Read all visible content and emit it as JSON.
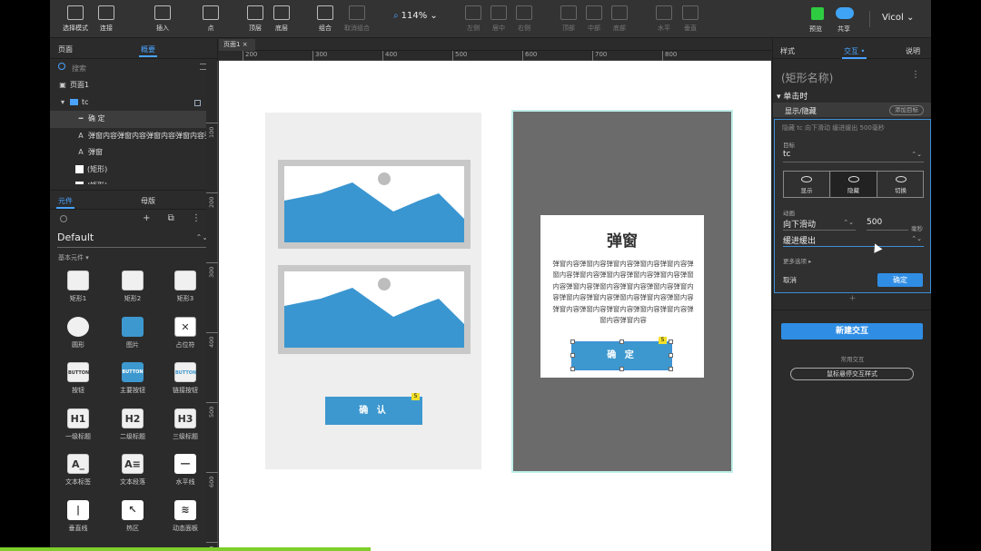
{
  "toolbar": {
    "left_tools": [
      {
        "label": "选择模式",
        "icon": "select-mode-icon"
      },
      {
        "label": "连接",
        "icon": "connect-icon"
      },
      {
        "label": "插入",
        "icon": "insert-icon"
      },
      {
        "label": "点",
        "icon": "point-icon"
      },
      {
        "label": "顶层",
        "icon": "bring-front-icon"
      },
      {
        "label": "底层",
        "icon": "send-back-icon"
      },
      {
        "label": "组合",
        "icon": "group-icon"
      },
      {
        "label": "取消组合",
        "icon": "ungroup-icon",
        "disabled": true
      }
    ],
    "zoom": "114%",
    "align_tools": [
      {
        "label": "左侧",
        "icon": "align-left-icon"
      },
      {
        "label": "居中",
        "icon": "align-center-icon"
      },
      {
        "label": "右侧",
        "icon": "align-right-icon"
      },
      {
        "label": "顶部",
        "icon": "align-top-icon"
      },
      {
        "label": "中部",
        "icon": "align-middle-icon"
      },
      {
        "label": "底部",
        "icon": "align-bottom-icon"
      },
      {
        "label": "水平",
        "icon": "distribute-horizontal-icon"
      },
      {
        "label": "垂直",
        "icon": "distribute-vertical-icon"
      }
    ],
    "preview_label": "预览",
    "share_label": "共享",
    "user": "Vicol"
  },
  "left_panel": {
    "tabs": [
      "页面",
      "概要"
    ],
    "active_tab": "概要",
    "search_placeholder": "搜索",
    "outline": [
      {
        "glyph": "▣",
        "label": "页面1",
        "indent": 0
      },
      {
        "glyph": "▾",
        "label": "tc",
        "indent": 0,
        "folder": true
      },
      {
        "glyph": "━",
        "label": "确 定",
        "indent": 1,
        "selected": true
      },
      {
        "glyph": "A",
        "label": "弹窗内容弹窗内容弹窗内容弹窗内容弹窗内容 5",
        "indent": 1
      },
      {
        "glyph": "A",
        "label": "弹窗",
        "indent": 1
      },
      {
        "glyph": "",
        "label": "(矩形)",
        "indent": 1,
        "rect": true
      },
      {
        "glyph": "",
        "label": "(矩形)",
        "indent": 1,
        "rect": true
      }
    ],
    "lib_tabs": [
      "元件",
      "母版"
    ],
    "library": "Default",
    "category": "基本元件 ▾",
    "widgets": [
      "矩形1",
      "矩形2",
      "矩形3",
      "圆形",
      "图片",
      "占位符",
      "按钮",
      "主要按钮",
      "链接按钮",
      "一级标题",
      "二级标题",
      "三级标题",
      "文本标签",
      "文本段落",
      "水平线",
      "垂直线",
      "热区",
      "动态面板"
    ],
    "widget_glyphs": {
      "按钮": "BUTTON",
      "主要按钮": "BUTTON",
      "链接按钮": "BUTTON",
      "一级标题": "H1",
      "二级标题": "H2",
      "三级标题": "H3",
      "文本标签": "A_",
      "文本段落": "A≡"
    }
  },
  "canvas": {
    "tab": "页面1",
    "ruler_h": [
      "0",
      "100",
      "200",
      "300",
      "400",
      "500",
      "600",
      "700",
      "800"
    ],
    "ruler_v": [
      "100",
      "200",
      "300",
      "400",
      "500",
      "600",
      "700"
    ],
    "confirm_label": "确 认",
    "modal_title": "弹窗",
    "modal_body": "弹窗内容弹窗内容弹窗内容弹窗内容弹窗内容弹窗内容弹窗内容弹窗内容弹窗内容弹窗内容弹窗内容弹窗内容弹窗内容弹窗内容弹窗内容弹窗内容弹窗内容弹窗内容弹窗内容弹窗内容弹窗内容弹窗内容弹窗内容弹窗内容弹窗内容弹窗内容弹窗内容弹窗内容",
    "ok_label": "确 定",
    "badge": "5"
  },
  "right_panel": {
    "tabs": [
      "样式",
      "交互 •",
      "说明"
    ],
    "active_tab": "交互 •",
    "shape_name": "(矩形名称)",
    "event": "▾ 单击时",
    "action": "显示/隐藏",
    "add_target": "添加目标",
    "summary": "隐藏 tc 向下滑动 缓进缓出 500毫秒",
    "target_label": "目标",
    "target": "tc",
    "visibility": [
      {
        "label": "显示",
        "icon": "show-eye-icon"
      },
      {
        "label": "隐藏",
        "icon": "hide-eye-icon",
        "selected": true
      },
      {
        "label": "切换",
        "icon": "toggle-eye-icon"
      }
    ],
    "animate_label": "动画",
    "animation": "向下滑动",
    "duration": "500",
    "duration_unit": "毫秒",
    "easing": "缓进缓出",
    "more_options": "更多选项 ▸",
    "cancel": "取消",
    "ok": "确定",
    "plus": "+",
    "new_interaction": "新建交互",
    "common_label": "常用交互",
    "hover_style": "鼠标悬停交互样式"
  }
}
